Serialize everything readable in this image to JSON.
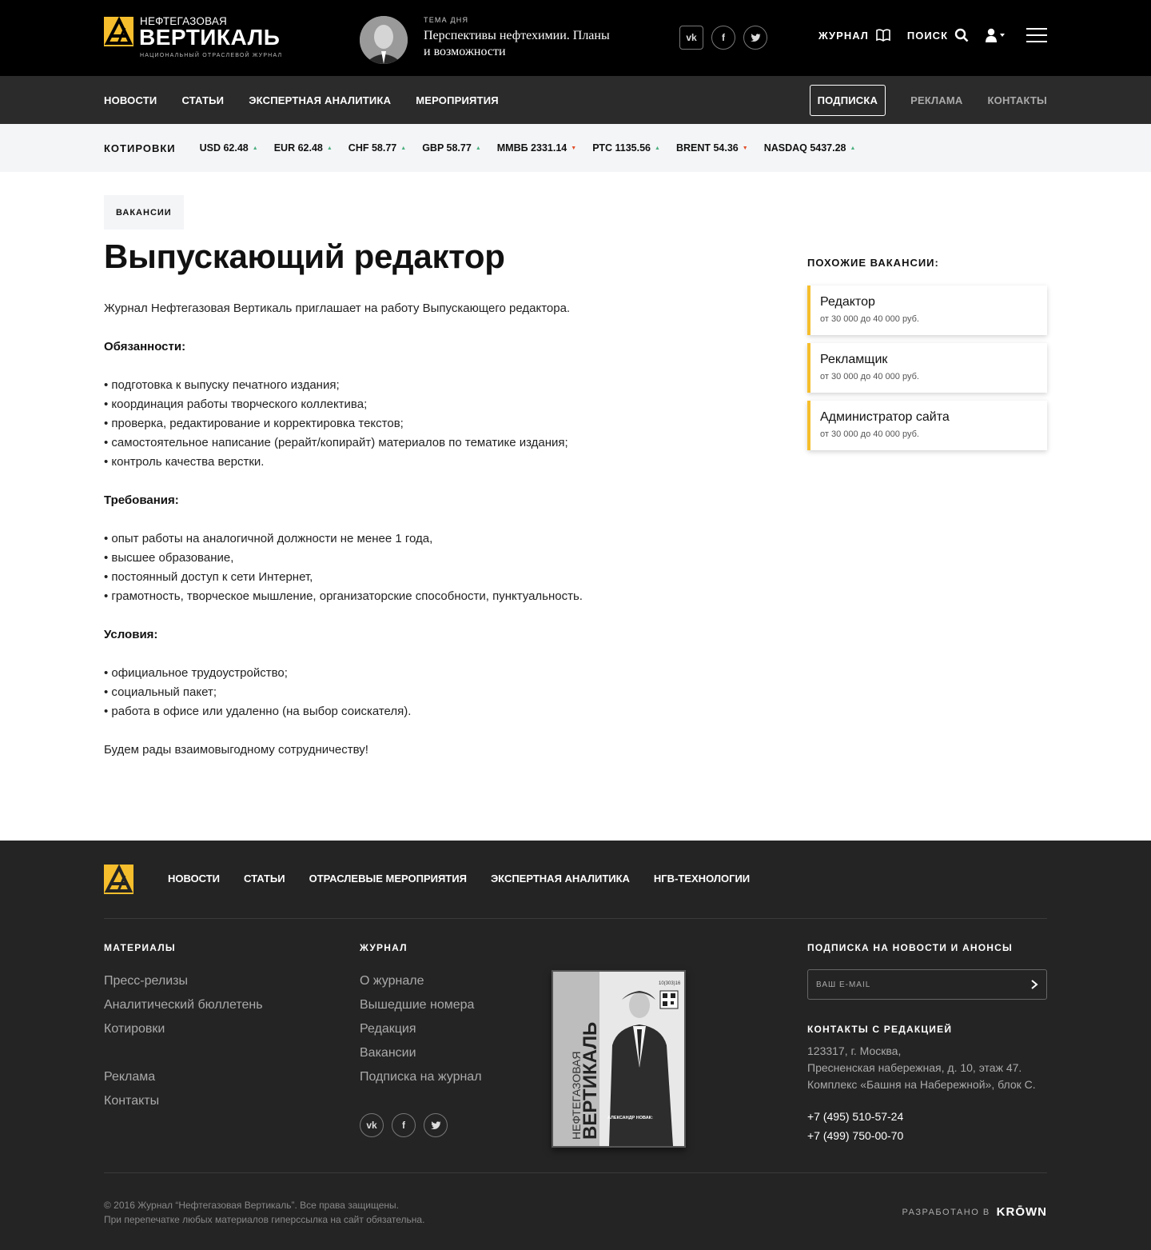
{
  "header": {
    "logo": {
      "line1": "НЕФТЕГАЗОВАЯ",
      "line2": "ВЕРТИКАЛЬ",
      "line3": "НАЦИОНАЛЬНЫЙ ОТРАСЛЕВОЙ ЖУРНАЛ",
      "accent": "#f6be2c"
    },
    "tema": {
      "label": "ТЕМА ДНЯ",
      "title": "Перспективы нефтехимии. Планы и возможности"
    },
    "social": [
      "vk-icon",
      "facebook-icon",
      "twitter-icon"
    ],
    "links": {
      "journal": "ЖУРНАЛ",
      "search": "ПОИСК"
    }
  },
  "nav": {
    "left": [
      "НОВОСТИ",
      "СТАТЬИ",
      "ЭКСПЕРТНАЯ АНАЛИТИКА",
      "МЕРОПРИЯТИЯ"
    ],
    "subscribe": "ПОДПИСКА",
    "ads": "РЕКЛАМА",
    "contacts": "КОНТАКТЫ"
  },
  "quotes": {
    "title": "КОТИРОВКИ",
    "items": [
      {
        "label": "USD 62.48",
        "dir": "up"
      },
      {
        "label": "EUR 62.48",
        "dir": "up"
      },
      {
        "label": "CHF 58.77",
        "dir": "up"
      },
      {
        "label": "GBP 58.77",
        "dir": "up"
      },
      {
        "label": "ММВБ 2331.14",
        "dir": "down"
      },
      {
        "label": "РТС 1135.56",
        "dir": "up"
      },
      {
        "label": "BRENT 54.36",
        "dir": "down"
      },
      {
        "label": "NASDAQ 5437.28",
        "dir": "up"
      }
    ],
    "colors": {
      "up": "#4caf80",
      "down": "#e2502a"
    }
  },
  "main": {
    "tag": "ВАКАНСИИ",
    "title": "Выпускающий редактор",
    "intro": "Журнал Нефтегазовая Вертикаль  приглашает на работу Выпускающего редактора.",
    "duties_h": "Обязанности:",
    "duties": [
      "• подготовка к выпуску печатного издания;",
      "• координация работы творческого коллектива;",
      "• проверка, редактирование и корректировка текстов;",
      "• самостоятельное написание (рерайт/копирайт) материалов по тематике издания;",
      "• контроль качества верстки."
    ],
    "req_h": "Требования:",
    "req": [
      "• опыт работы на аналогичной должности не менее 1 года,",
      "• высшее образование,",
      "• постоянный доступ к сети Интернет,",
      "• грамотность, творческое мышление, организаторские способности, пунктуальность."
    ],
    "cond_h": "Условия:",
    "cond": [
      "• официальное трудоустройство;",
      "• социальный пакет;",
      "• работа в офисе или удаленно (на выбор соискателя)."
    ],
    "outro": "Будем рады взаимовыгодному сотрудничеству!"
  },
  "sidebar": {
    "title": "ПОХОЖИЕ ВАКАНСИИ:",
    "items": [
      {
        "title": "Редактор",
        "salary": "от 30 000 до 40 000 руб."
      },
      {
        "title": "Рекламщик",
        "salary": "от 30 000 до 40 000 руб."
      },
      {
        "title": "Администратор сайта",
        "salary": "от 30 000 до 40 000 руб."
      }
    ]
  },
  "footer": {
    "nav": [
      "НОВОСТИ",
      "СТАТЬИ",
      "ОТРАСЛЕВЫЕ МЕРОПРИЯТИЯ",
      "ЭКСПЕРТНАЯ АНАЛИТИКА",
      "НГВ-ТЕХНОЛОГИИ"
    ],
    "materials_h": "МАТЕРИАЛЫ",
    "materials": [
      "Пресс-релизы",
      "Аналитический бюллетень",
      "Котировки"
    ],
    "materials2": [
      "Реклама",
      "Контакты"
    ],
    "journal_h": "ЖУРНАЛ",
    "journal": [
      "О журнале",
      "Вышедшие номера",
      "Редакция",
      "Вакансии",
      "Подписка на журнал"
    ],
    "cover": {
      "issue": "10(303)16",
      "title1": "НЕФТЕГАЗОВАЯ",
      "title2": "ВЕРТИКАЛЬ",
      "caption": "АЛЕКСАНДР НОВАК:"
    },
    "subscribe_h": "ПОДПИСКА НА НОВОСТИ И АНОНСЫ",
    "email_placeholder": "ВАШ E-MAIL",
    "contacts_h": "КОНТАКТЫ С РЕДАКЦИЕЙ",
    "address": [
      "123317, г. Москва,",
      "Пресненская набережная, д. 10, этаж 47.",
      "Комплекс «Башня на Набережной», блок С."
    ],
    "phones": [
      "+7 (495) 510-57-24",
      "+7 (499) 750-00-70"
    ],
    "copyright1": "© 2016 Журнал “Нефтегазовая Вертикаль”. Все права защищены.",
    "copyright2": "При перепечатке любых материалов гиперссылка на сайт обязательна.",
    "dev_label": "РАЗРАБОТАНО В",
    "dev_name": "KRŌWN"
  }
}
